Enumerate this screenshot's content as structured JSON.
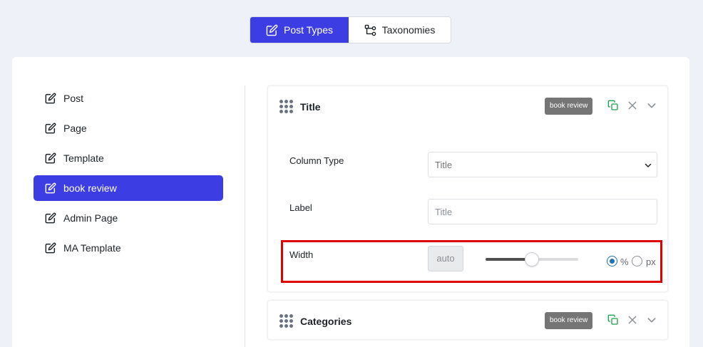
{
  "top_tabs": [
    {
      "label": "Post Types",
      "icon": "edit-icon",
      "active": true
    },
    {
      "label": "Taxonomies",
      "icon": "hierarchy-icon",
      "active": false
    }
  ],
  "sidebar": {
    "items": [
      {
        "label": "Post",
        "icon": "edit-icon"
      },
      {
        "label": "Page",
        "icon": "edit-icon"
      },
      {
        "label": "Template",
        "icon": "edit-icon"
      },
      {
        "label": "book review",
        "icon": "edit-icon",
        "active": true
      },
      {
        "label": "Admin Page",
        "icon": "edit-icon"
      },
      {
        "label": "MA Template",
        "icon": "edit-icon"
      }
    ]
  },
  "cards": [
    {
      "title": "Title",
      "badge": "book review",
      "fields": {
        "column_type": {
          "label": "Column Type",
          "value": "Title"
        },
        "label": {
          "label": "Label",
          "placeholder": "Title"
        },
        "width": {
          "label": "Width",
          "value": "auto",
          "slider_fraction": 0.5,
          "units": [
            "%",
            "px"
          ],
          "selected_unit": "%"
        }
      }
    },
    {
      "title": "Categories",
      "badge": "book review"
    }
  ],
  "colors": {
    "accent": "#3c3ee4",
    "badge": "#757575",
    "copy_icon": "#1aa34a",
    "close_icon": "#8a8f96",
    "highlight": "#e00000"
  }
}
